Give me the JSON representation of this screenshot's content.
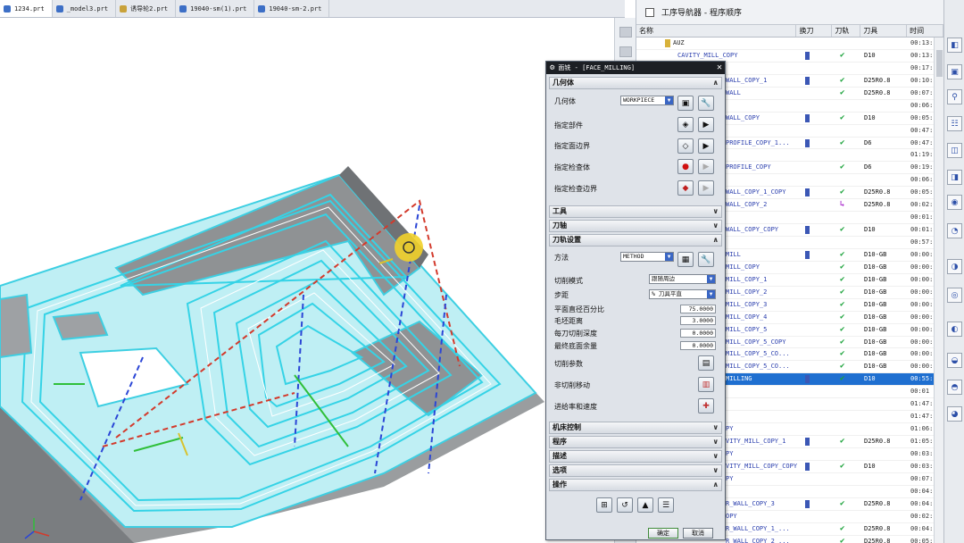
{
  "file_tabs": [
    {
      "label": "1234.prt",
      "active": true
    },
    {
      "label": "_model3.prt",
      "active": false
    },
    {
      "label": "诱导轮2.prt",
      "active": false
    },
    {
      "label": "19040-sm(1).prt",
      "active": false
    },
    {
      "label": "19040-sm-2.prt",
      "active": false
    }
  ],
  "navigator": {
    "title": "工序导航器 - 程序顺序",
    "columns": {
      "name": "名称",
      "tool_change": "换刀",
      "toolpath": "刀轨",
      "tool": "刀具",
      "time": "时间"
    },
    "rows": [
      {
        "name": "AUZ",
        "tc": false,
        "path": "",
        "tool": "",
        "time": "00:13:...",
        "root": true
      },
      {
        "name": "CAVITY_MILL_COPY",
        "tc": true,
        "path": "ok",
        "tool": "D10",
        "time": "00:13:"
      },
      {
        "name": "",
        "tc": false,
        "path": "",
        "tool": "",
        "time": "00:17:"
      },
      {
        "name": "WALL_COPY_1",
        "tc": true,
        "path": "ok",
        "tool": "D25R0.8",
        "time": "00:10:"
      },
      {
        "name": "WALL",
        "tc": false,
        "path": "ok",
        "tool": "D25R0.8",
        "time": "00:07:"
      },
      {
        "name": "",
        "tc": false,
        "path": "",
        "tool": "",
        "time": "00:06:"
      },
      {
        "name": "WALL_COPY",
        "tc": true,
        "path": "ok",
        "tool": "D10",
        "time": "00:05:"
      },
      {
        "name": "",
        "tc": false,
        "path": "",
        "tool": "",
        "time": "00:47:"
      },
      {
        "name": "PROFILE_COPY_1...",
        "tc": true,
        "path": "ok",
        "tool": "D6",
        "time": "00:47:"
      },
      {
        "name": "",
        "tc": false,
        "path": "",
        "tool": "",
        "time": "01:19:"
      },
      {
        "name": "PROFILE_COPY",
        "tc": false,
        "path": "ok",
        "tool": "D6",
        "time": "00:19:"
      },
      {
        "name": "",
        "tc": false,
        "path": "",
        "tool": "",
        "time": "00:06:"
      },
      {
        "name": "WALL_COPY_1_COPY",
        "tc": true,
        "path": "ok",
        "tool": "D25R0.8",
        "time": "00:05:"
      },
      {
        "name": "WALL_COPY_2",
        "tc": false,
        "path": "pending",
        "tool": "D25R0.8",
        "time": "00:02:"
      },
      {
        "name": "",
        "tc": false,
        "path": "",
        "tool": "",
        "time": "00:01:"
      },
      {
        "name": "WALL_COPY_COPY",
        "tc": true,
        "path": "ok",
        "tool": "D10",
        "time": "00:01:"
      },
      {
        "name": "",
        "tc": false,
        "path": "",
        "tool": "",
        "time": "00:57:"
      },
      {
        "name": "MILL",
        "tc": true,
        "path": "ok",
        "tool": "D10-GB",
        "time": "00:00:"
      },
      {
        "name": "MILL_COPY",
        "tc": false,
        "path": "ok",
        "tool": "D10-GB",
        "time": "00:00:"
      },
      {
        "name": "MILL_COPY_1",
        "tc": false,
        "path": "ok",
        "tool": "D10-GB",
        "time": "00:00:"
      },
      {
        "name": "MILL_COPY_2",
        "tc": false,
        "path": "ok",
        "tool": "D10-GB",
        "time": "00:00:"
      },
      {
        "name": "MILL_COPY_3",
        "tc": false,
        "path": "ok",
        "tool": "D10-GB",
        "time": "00:00:"
      },
      {
        "name": "MILL_COPY_4",
        "tc": false,
        "path": "ok",
        "tool": "D10-GB",
        "time": "00:00:"
      },
      {
        "name": "MILL_COPY_5",
        "tc": false,
        "path": "ok",
        "tool": "D10-GB",
        "time": "00:00:"
      },
      {
        "name": "MILL_COPY_5_COPY",
        "tc": false,
        "path": "ok",
        "tool": "D10-GB",
        "time": "00:00:"
      },
      {
        "name": "MILL_COPY_5_CO...",
        "tc": false,
        "path": "ok",
        "tool": "D10-GB",
        "time": "00:00:"
      },
      {
        "name": "MILL_COPY_5_CO...",
        "tc": false,
        "path": "ok",
        "tool": "D10-GB",
        "time": "00:00:"
      },
      {
        "name": "MILLING",
        "tc": true,
        "path": "ok",
        "tool": "D10",
        "time": "00:55:",
        "selected": true
      },
      {
        "name": "",
        "tc": false,
        "path": "",
        "tool": "",
        "time": "00:01"
      },
      {
        "name": "",
        "tc": false,
        "path": "",
        "tool": "",
        "time": "01:47:"
      },
      {
        "name": "",
        "tc": false,
        "path": "",
        "tool": "",
        "time": "01:47:"
      },
      {
        "name": "PY",
        "tc": false,
        "path": "",
        "tool": "",
        "time": "01:06:"
      },
      {
        "name": "VITY_MILL_COPY_1",
        "tc": true,
        "path": "ok",
        "tool": "D25R0.8",
        "time": "01:05:"
      },
      {
        "name": "PY",
        "tc": false,
        "path": "",
        "tool": "",
        "time": "00:03:"
      },
      {
        "name": "VITY_MILL_COPY_COPY",
        "tc": true,
        "path": "ok",
        "tool": "D10",
        "time": "00:03:"
      },
      {
        "name": "PY",
        "tc": false,
        "path": "",
        "tool": "",
        "time": "00:07:"
      },
      {
        "name": "",
        "tc": false,
        "path": "",
        "tool": "",
        "time": "00:04:"
      },
      {
        "name": "R_WALL_COPY_3",
        "tc": true,
        "path": "ok",
        "tool": "D25R0.8",
        "time": "00:04:"
      },
      {
        "name": "OPY",
        "tc": false,
        "path": "",
        "tool": "",
        "time": "00:02:"
      },
      {
        "name": "R_WALL_COPY_1_...",
        "tc": false,
        "path": "ok",
        "tool": "D25R0.8",
        "time": "00:04:"
      },
      {
        "name": "R_WALL_COPY_2_...",
        "tc": false,
        "path": "ok",
        "tool": "D25R0.8",
        "time": "00:05:"
      }
    ]
  },
  "dialog": {
    "title": "面铣 - [FACE_MILLING]",
    "groups": {
      "geometry": "几何体",
      "tool": "工具",
      "axis": "刀轴",
      "path_settings": "刀轨设置",
      "machine_control": "机床控制",
      "program": "程序",
      "description": "描述",
      "options": "选项",
      "actions": "操作"
    },
    "geometry_label": "几何体",
    "geometry_value": "WORKPIECE",
    "specify_part": "指定部件",
    "specify_face_boundary": "指定面边界",
    "specify_check": "指定检查体",
    "specify_check_boundary": "指定检查边界",
    "method_label": "方法",
    "method_value": "METHOD",
    "cut_mode_label": "切削模式",
    "cut_mode_value": "跟随周边",
    "stepover_label": "步距",
    "stepover_value": "% 刀具平直",
    "plane_dia_pct_label": "平面直径百分比",
    "plane_dia_pct_value": "75.0000",
    "blank_dist_label": "毛坯距离",
    "blank_dist_value": "3.0000",
    "depth_per_cut_label": "每刀切削深度",
    "depth_per_cut_value": "0.0000",
    "final_floor_label": "最终底面余量",
    "final_floor_value": "0.0000",
    "cut_params_label": "切削参数",
    "non_cut_label": "非切削移动",
    "feeds_label": "进给率和速度",
    "ok_label": "确定",
    "cancel_label": "取消"
  },
  "colors": {
    "toolpath": "#35d3e6",
    "selected_row": "#1f6fd0",
    "dialog_title": "#1c1f24",
    "check_green": "#1aa23a"
  }
}
